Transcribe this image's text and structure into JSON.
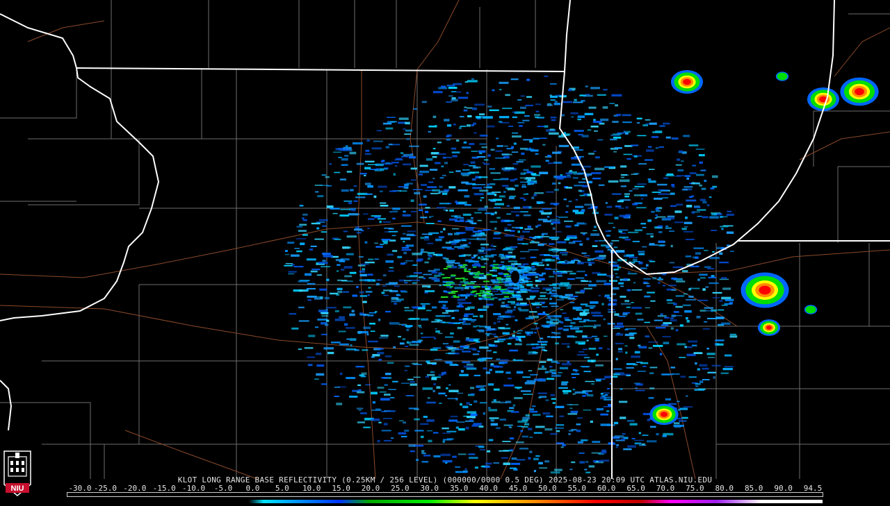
{
  "product": {
    "title": "KLOT LONG RANGE BASE REFLECTIVITY (0.25KM / 256 LEVEL) (000000/0000 0.5 DEG) 2025-08-23 20:09 UTC  ATLAS.NIU.EDU"
  },
  "scale": {
    "labels": [
      "-30.0",
      "-25.0",
      "-20.0",
      "-15.0",
      "-10.0",
      "-5.0",
      "0.0",
      "5.0",
      "10.0",
      "15.0",
      "20.0",
      "25.0",
      "30.0",
      "35.0",
      "40.0",
      "45.0",
      "50.0",
      "55.0",
      "60.0",
      "65.0",
      "70.0",
      "75.0",
      "80.0",
      "85.0",
      "90.0",
      "94.5"
    ],
    "values": [
      -30,
      -25,
      -20,
      -15,
      -10,
      -5,
      0,
      5,
      10,
      15,
      20,
      25,
      30,
      35,
      40,
      45,
      50,
      55,
      60,
      65,
      70,
      75,
      80,
      85,
      90,
      94.5
    ],
    "colors": {
      "below_zero": "#ffffff",
      "light": "#00e5ff",
      "blue": "#0033ff",
      "green": "#00d000",
      "yellow": "#ffff00",
      "orange": "#ff8c00",
      "red": "#ff0000",
      "magenta": "#ff00ff",
      "purple": "#a020f0",
      "white": "#ffffff"
    }
  },
  "logo": {
    "text": "NIU",
    "color": "#c8102e"
  },
  "map": {
    "background": "#000000",
    "state_border_color": "#ffffff",
    "county_line_color": "#7a7a7a",
    "highway_color": "#8b4a2a",
    "echo_groups": [
      {
        "name": "northeast-cell-1",
        "max_dbz": 55
      },
      {
        "name": "northeast-cell-2",
        "max_dbz": 60
      },
      {
        "name": "northeast-cell-3",
        "max_dbz": 55
      },
      {
        "name": "east-cell-1",
        "max_dbz": 55
      },
      {
        "name": "east-cell-2",
        "max_dbz": 40
      },
      {
        "name": "southeast-cell",
        "max_dbz": 35
      }
    ]
  }
}
